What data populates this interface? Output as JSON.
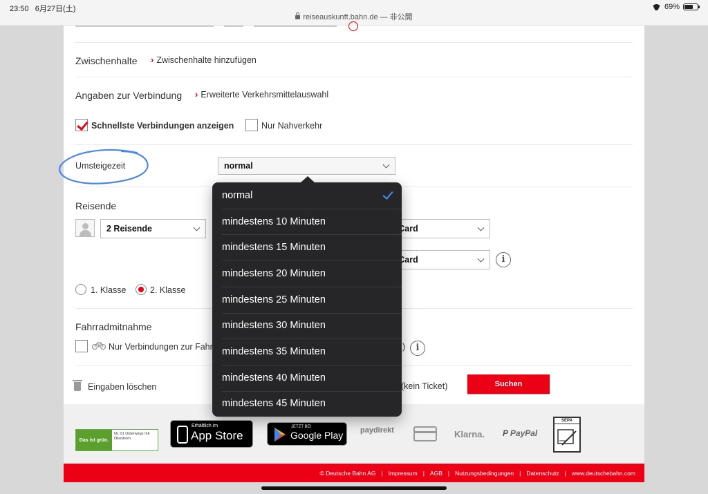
{
  "status": {
    "time": "23:50",
    "date": "6月27日(土)",
    "url": "reiseauskunft.bahn.de",
    "url_suffix": " — 非公開",
    "battery": "69%"
  },
  "form": {
    "zwischenhalte_label": "Zwischenhalte",
    "zwischenhalte_link": "Zwischenhalte hinzufügen",
    "verbindung_label": "Angaben zur Verbindung",
    "verbindung_link": "Erweiterte Verkehrsmittelauswahl",
    "fastest_label": "Schnellste Verbindungen anzeigen",
    "fastest_checked": true,
    "regional_label": "Nur Nahverkehr",
    "regional_checked": false,
    "umsteigezeit_label": "Umsteigezeit",
    "umsteigezeit_value": "normal",
    "reisende_label": "Reisende",
    "reisende_value": "2 Reisende",
    "bahncard_1": "hnCard",
    "bahncard_2": "hnCard",
    "class_1": "1. Klasse",
    "class_2": "2. Klasse",
    "selected_class": 2,
    "fahrrad_label": "Fahrradmitnahme",
    "fahrrad_option": "Nur Verbindungen zur Fahr",
    "fahrrad_trailing": ")",
    "clear_label": "Eingaben löschen",
    "ticket_label": "(kein Ticket)",
    "search_button": "Suchen"
  },
  "dropdown": {
    "selected_index": 0,
    "options": [
      "normal",
      "mindestens 10 Minuten",
      "mindestens 15 Minuten",
      "mindestens 20 Minuten",
      "mindestens 25 Minuten",
      "mindestens 30 Minuten",
      "mindestens 35 Minuten",
      "mindestens 40 Minuten",
      "mindestens 45 Minuten"
    ]
  },
  "footer": {
    "eco_left": "Das ist grün.",
    "eco_right": "Nr. 01 Unterwegs mit Ökostrom.",
    "appstore_small": "Erhältlich im",
    "appstore_big": "App Store",
    "googleplay_small": "JETZT BEI",
    "googleplay_big": "Google Play",
    "paydirekt": "paydirekt",
    "klarna": "Klarna.",
    "paypal": "PayPal",
    "sepa": "SEPA",
    "links": [
      "© Deutsche Bahn AG",
      "Impressum",
      "AGB",
      "Nutzungsbedingungen",
      "Datenschutz",
      "www.deutschebahn.com"
    ]
  },
  "colors": {
    "brand_red": "#ec0016",
    "annotation_blue": "#4a86e8",
    "check_blue": "#4a8df6"
  }
}
